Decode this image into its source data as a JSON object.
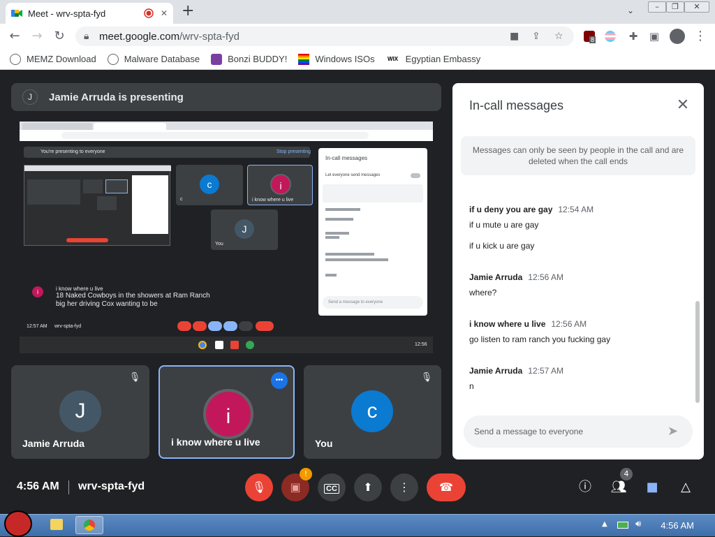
{
  "browser": {
    "tab_title": "Meet - wrv-spta-fyd",
    "new_tab_label": "+",
    "url_host": "meet.google.com",
    "url_path": "/wrv-spta-fyd",
    "bookmarks": [
      {
        "label": "MEMZ Download",
        "icon": "globe-icon"
      },
      {
        "label": "Malware Database",
        "icon": "globe-icon"
      },
      {
        "label": "Bonzi BUDDY!",
        "icon": "bonzi-icon"
      },
      {
        "label": "Windows ISOs",
        "icon": "rainbow-flag-icon"
      },
      {
        "label": "Egyptian Embassy",
        "icon": "wix-icon"
      }
    ],
    "extension_badge": "8"
  },
  "meet": {
    "presenter_initial": "J",
    "presenting_text": "Jamie Arruda is presenting",
    "share": {
      "youre_presenting": "You're presenting to everyone",
      "stop_presenting": "Stop presenting",
      "chat_title": "In-call messages",
      "let_everyone": "Let everyone send messages",
      "notice": "Messages can only be seen by people in the call and are deleted when the call ends",
      "input_placeholder": "Send a message to everyone",
      "caption_name": "i know where u live",
      "caption_line1": "18 Naked Cowboys in the showers at Ram Ranch",
      "caption_line2": "big her driving Cox wanting to be",
      "time": "12:57 AM",
      "code": "wrv-spta-fyd",
      "tray_time": "12:56",
      "tile_labels": [
        "c",
        "i know where u live",
        "You"
      ]
    },
    "participants": [
      {
        "initial": "J",
        "name": "Jamie Arruda",
        "color": "#445767",
        "muted": true
      },
      {
        "initial": "i",
        "name": "i know where u live",
        "color": "#c2185b",
        "muted": false
      },
      {
        "initial": "c",
        "name": "You",
        "color": "#0b7ad1",
        "muted": true
      }
    ],
    "time": "4:56 AM",
    "code": "wrv-spta-fyd",
    "people_count": "4",
    "camera_warning": "!"
  },
  "chat": {
    "title": "In-call messages",
    "notice": "Messages can only be seen by people in the call and are deleted when the call ends",
    "messages": [
      {
        "sender": "if u deny you are gay",
        "time": "12:54 AM",
        "lines": [
          "if u mute u are gay",
          "if u kick u are gay"
        ]
      },
      {
        "sender": "Jamie Arruda",
        "time": "12:56 AM",
        "lines": [
          "where?"
        ]
      },
      {
        "sender": "i know where u live",
        "time": "12:56 AM",
        "lines": [
          "go listen to ram ranch you fucking gay"
        ]
      },
      {
        "sender": "Jamie Arruda",
        "time": "12:57 AM",
        "lines": [
          "n"
        ]
      }
    ],
    "input_placeholder": "Send a message to everyone"
  },
  "taskbar": {
    "time": "4:56 AM"
  },
  "colors": {
    "meet_bg": "#202124",
    "tile_bg": "#3c4043",
    "danger": "#ea4335",
    "accent": "#1a73e8"
  }
}
